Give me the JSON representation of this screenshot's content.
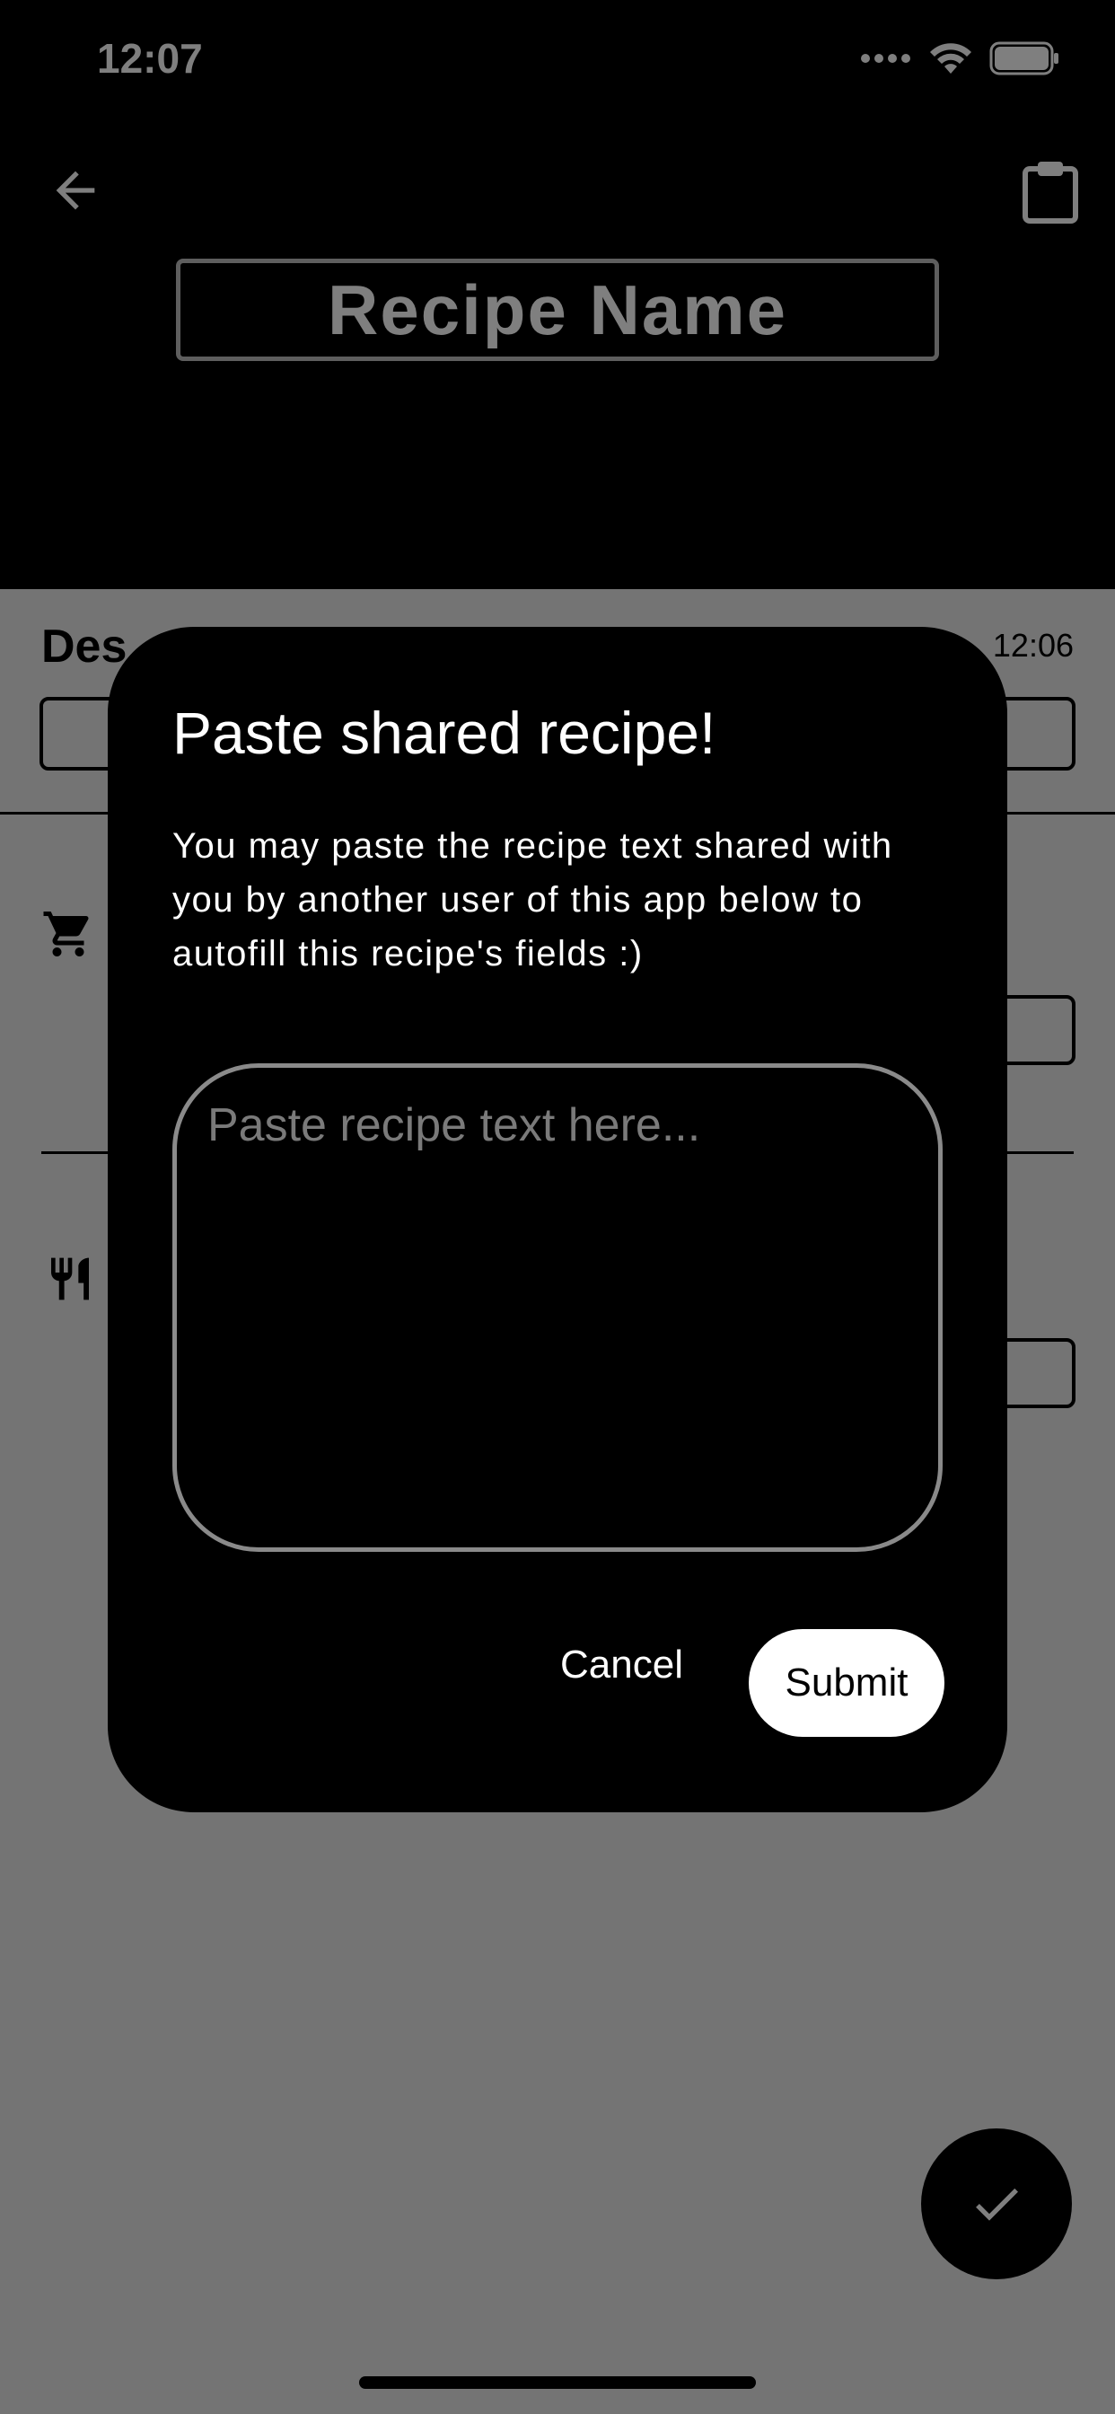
{
  "status_bar": {
    "time": "12:07",
    "signal_icon": "cellular-dots-icon",
    "wifi_icon": "wifi-icon",
    "battery_icon": "battery-icon"
  },
  "app_bar": {
    "back_icon": "arrow-left-icon",
    "clipboard_icon": "clipboard-icon",
    "recipe_name_placeholder": "Recipe Name"
  },
  "background": {
    "description_label": "Des",
    "description_time": "12:06",
    "ingredients_icon": "shopping-cart-icon",
    "steps_icon": "utensils-icon",
    "fab_icon": "check-icon"
  },
  "dialog": {
    "title": "Paste shared recipe!",
    "body": "You may paste the recipe text shared with you by another user of this app below to autofill this recipe's fields :)",
    "input_placeholder": "Paste recipe text here...",
    "input_value": "",
    "cancel_label": "Cancel",
    "submit_label": "Submit"
  },
  "colors": {
    "header_bg": "#000000",
    "body_bg": "#e8e8e8",
    "dialog_bg": "#000000",
    "submit_bg": "#ffffff"
  }
}
